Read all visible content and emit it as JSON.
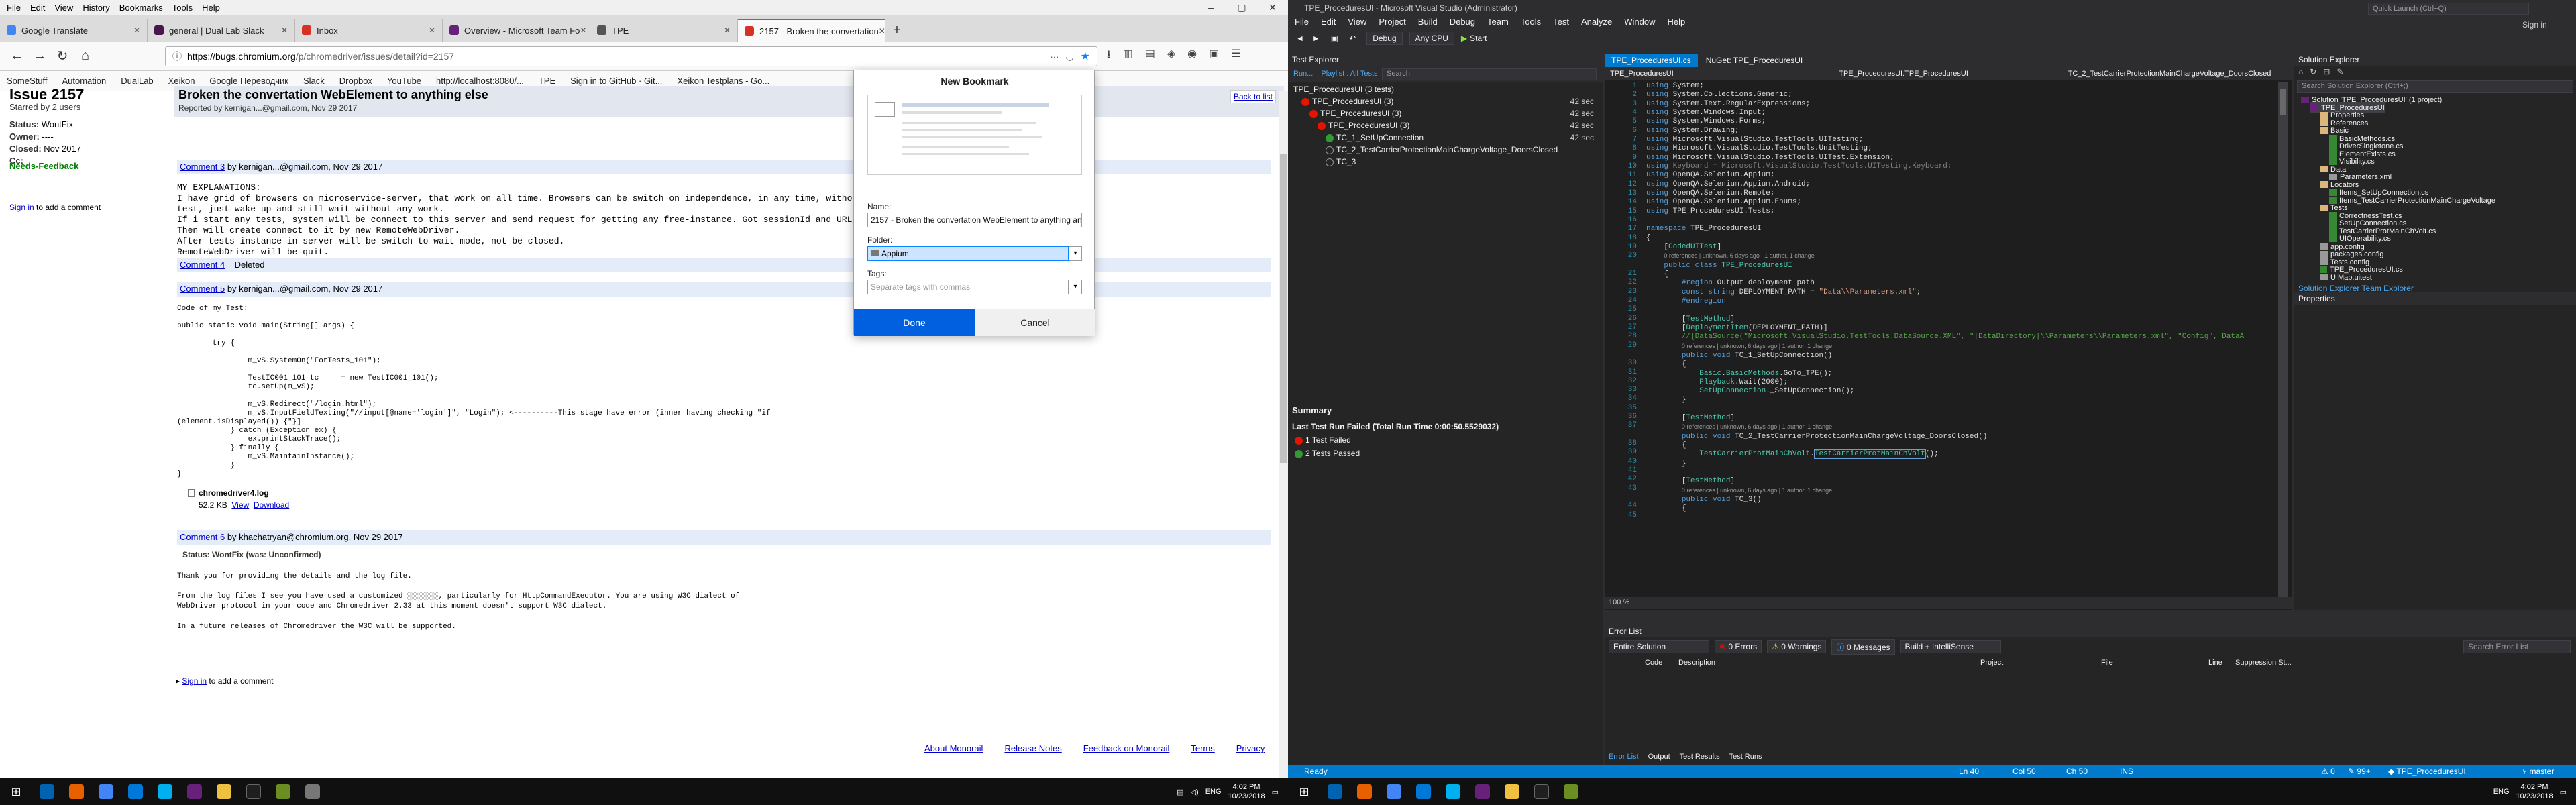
{
  "firefox": {
    "menu": [
      "File",
      "Edit",
      "View",
      "History",
      "Bookmarks",
      "Tools",
      "Help"
    ],
    "tabs": [
      {
        "label": "Google Translate",
        "color": "#4285f4"
      },
      {
        "label": "general | Dual Lab Slack",
        "color": "#4a154b"
      },
      {
        "label": "Inbox",
        "color": "#d93025"
      },
      {
        "label": "Overview - Microsoft Team Fo",
        "color": "#68217a"
      },
      {
        "label": "TPE",
        "color": "#555"
      },
      {
        "label": "2157 - Broken the convertation",
        "color": "#d93025"
      }
    ],
    "url_domain": "https://bugs.chromium.org",
    "url_path": "/p/chromedriver/issues/detail?id=2157",
    "bookmarks": [
      "SomeStuff",
      "Automation",
      "DualLab",
      "Xeikon",
      "Google Переводчик",
      "Slack",
      "Dropbox",
      "YouTube",
      "http://localhost:8080/...",
      "TPE",
      "Sign in to GitHub · Git...",
      "Xeikon Testplans - Go..."
    ],
    "issue": {
      "id": "Issue 2157",
      "title": "Broken the convertation WebElement to anything else",
      "reported": "Reported by kernigan...@gmail.com, Nov 29 2017",
      "back": "Back to list",
      "starred": "Starred by 2 users",
      "status_label": "Status:",
      "status": "WontFix",
      "owner_label": "Owner:",
      "owner": "----",
      "closed_label": "Closed:",
      "closed": "Nov 2017",
      "cc_label": "Cc:",
      "cc": "",
      "needs_label": "Needs-Feedback",
      "sidebar_signin": "Sign in",
      "sidebar_signin_rest": " to add a comment"
    },
    "comments": {
      "c3_link": "Comment 3",
      "c3_by": " by kernigan...@gmail.com, Nov 29 2017",
      "c3_body": "MY EXPLANATIONS:\nI have grid of browsers on microservice-server, that work on all time. Browsers can be switch on independence, in any time, without\ntest, just wake up and still wait without any work.\nIf i start any tests, system will be connect to this server and send request for getting any free-instance. Got sessionId and URL.\nThen will create connect to it by new RemoteWebDriver.\nAfter tests instance in server will be switch to wait-mode, not be closed.\nRemoteWebDriver will be quit.",
      "c4_link": "Comment 4",
      "c4_del": "Deleted",
      "c5_link": "Comment 5",
      "c5_by": " by kernigan...@gmail.com, Nov 29 2017",
      "c5_body": "Code of my Test:\n\npublic static void main(String[] args) {\n\n        try {\n\n                m_vS.SystemOn(\"ForTests_101\");\n\n                TestIC001_101 tc     = new TestIC001_101();\n                tc.setUp(m_vS);\n\n                m_vS.Redirect(\"/login.html\");\n                m_vS.InputFieldTexting(\"//input[@name='login']\", \"Login\"); <----------This stage have error (inner having checking \"if\n(element.isDisplayed()) {\"}]\n            } catch (Exception ex) {\n                ex.printStackTrace();\n            } finally {\n                m_vS.MaintainInstance();\n            }\n}",
      "att_name": "chromedriver4.log",
      "att_size": "52.2 KB",
      "att_view": "View",
      "att_dl": "Download",
      "c6_link": "Comment 6",
      "c6_by": " by khachatryan@chromium.org, Nov 29 2017",
      "c6_status": "Status: WontFix (was: Unconfirmed)",
      "c6_body": "Thank you for providing the details and the log file.\n\nFrom the log files I see you have used a customized ░░░░░░░, particularly for HttpCommandExecutor. You are using W3C dialect of\nWebDriver protocol in your code and Chromedriver 2.33 at this moment doesn't support W3C dialect.\n\nIn a future releases of Chromedriver the W3C will be supported.",
      "bottom_signin": "Sign in",
      "bottom_rest": " to add a comment"
    },
    "footer": [
      "About Monorail",
      "Release Notes",
      "Feedback on Monorail",
      "Terms",
      "Privacy"
    ],
    "bookmark_panel": {
      "title": "New Bookmark",
      "name_label": "Name:",
      "name_value": "2157 - Broken the convertation WebElement to anything anot",
      "folder_label": "Folder:",
      "folder_value": "Appium",
      "tags_label": "Tags:",
      "tags_placeholder": "Separate tags with commas",
      "done": "Done",
      "cancel": "Cancel"
    }
  },
  "vs": {
    "title": "TPE_ProceduresUI - Microsoft Visual Studio (Administrator)",
    "menu": [
      "File",
      "Edit",
      "View",
      "Project",
      "Build",
      "Debug",
      "Team",
      "Tools",
      "Test",
      "Analyze",
      "Window",
      "Help"
    ],
    "toolbar": {
      "start": "Start",
      "config": "Debug",
      "platform": "Any CPU"
    },
    "quick_launch": "Quick Launch (Ctrl+Q)",
    "signin": "Sign in",
    "test_explorer": {
      "title": "Test Explorer",
      "run": "Run...",
      "playlist": "Playlist : All Tests",
      "search": "Search",
      "rows": [
        {
          "label": "TPE_ProceduresUI (3 tests)",
          "dur": "",
          "icon": "none",
          "indent": 0
        },
        {
          "label": "TPE_ProceduresUI (3)",
          "dur": "42 sec",
          "icon": "fail",
          "indent": 1
        },
        {
          "label": "TPE_ProceduresUI (3)",
          "dur": "42 sec",
          "icon": "fail",
          "indent": 2
        },
        {
          "label": "TPE_ProceduresUI (3)",
          "dur": "42 sec",
          "icon": "fail",
          "indent": 3
        },
        {
          "label": "TC_1_SetUpConnection",
          "dur": "42 sec",
          "icon": "pass",
          "indent": 4
        },
        {
          "label": "TC_2_TestCarrierProtectionMainChargeVoltage_DoorsClosed",
          "dur": "",
          "icon": "nrun",
          "indent": 4
        },
        {
          "label": "TC_3",
          "dur": "",
          "icon": "nrun",
          "indent": 4
        }
      ],
      "summary_title": "Summary",
      "last_run": "Last Test Run Failed (Total Run Time 0:00:50.5529032)",
      "failed": "1 Test Failed",
      "passed": "2 Tests Passed"
    },
    "editor": {
      "tabs": [
        "TPE_ProceduresUI.cs",
        "NuGet: TPE_ProceduresUI"
      ],
      "nav": [
        "TPE_ProceduresUI",
        "TPE_ProceduresUI.TPE_ProceduresUI",
        "TC_2_TestCarrierProtectionMainChargeVoltage_DoorsClosed"
      ],
      "zoom": "100 %"
    },
    "solution": {
      "title": "Solution Explorer",
      "search": "Search Solution Explorer (Ctrl+;)",
      "items": [
        {
          "label": "Solution 'TPE_ProceduresUI' (1 project)",
          "kind": "sol",
          "indent": 0
        },
        {
          "label": "TPE_ProceduresUI",
          "kind": "proj",
          "indent": 1
        },
        {
          "label": "Properties",
          "kind": "fold",
          "indent": 2
        },
        {
          "label": "References",
          "kind": "fold",
          "indent": 2
        },
        {
          "label": "Basic",
          "kind": "fold",
          "indent": 2
        },
        {
          "label": "BasicMethods.cs",
          "kind": "cs",
          "indent": 3
        },
        {
          "label": "DriverSingletone.cs",
          "kind": "cs",
          "indent": 3
        },
        {
          "label": "ElementExists.cs",
          "kind": "cs",
          "indent": 3
        },
        {
          "label": "Visibility.cs",
          "kind": "cs",
          "indent": 3
        },
        {
          "label": "Data",
          "kind": "fold",
          "indent": 2
        },
        {
          "label": "Parameters.xml",
          "kind": "file",
          "indent": 3
        },
        {
          "label": "Locators",
          "kind": "fold",
          "indent": 2
        },
        {
          "label": "Items_SetUpConnection.cs",
          "kind": "cs",
          "indent": 3
        },
        {
          "label": "Items_TestCarrierProtectionMainChargeVoltage",
          "kind": "cs",
          "indent": 3
        },
        {
          "label": "Tests",
          "kind": "fold",
          "indent": 2
        },
        {
          "label": "CorrectnessTest.cs",
          "kind": "cs",
          "indent": 3
        },
        {
          "label": "SetUpConnection.cs",
          "kind": "cs",
          "indent": 3
        },
        {
          "label": "TestCarrierProtMainChVolt.cs",
          "kind": "cs",
          "indent": 3
        },
        {
          "label": "UIOperability.cs",
          "kind": "cs",
          "indent": 3
        },
        {
          "label": "app.config",
          "kind": "file",
          "indent": 2
        },
        {
          "label": "packages.config",
          "kind": "file",
          "indent": 2
        },
        {
          "label": "Tests.config",
          "kind": "file",
          "indent": 2
        },
        {
          "label": "TPE_ProceduresUI.cs",
          "kind": "cs",
          "indent": 2
        },
        {
          "label": "UIMap.uitest",
          "kind": "file",
          "indent": 2
        }
      ],
      "tabs": "Solution Explorer   Team Explorer",
      "properties": "Properties"
    },
    "error_list": {
      "title": "Error List",
      "scope": "Entire Solution",
      "errors": "0 Errors",
      "warnings": "0 Warnings",
      "messages": "0 Messages",
      "build": "Build + IntelliSense",
      "search": "Search Error List",
      "cols": [
        "Code",
        "Description",
        "Project",
        "File",
        "Line",
        "Suppression St..."
      ],
      "tabs": [
        "Error List",
        "Output",
        "Test Results",
        "Test Runs"
      ]
    },
    "status": {
      "ready": "Ready",
      "ln": "Ln 40",
      "col": "Col 50",
      "ch": "Ch 50",
      "ins": "INS",
      "warn": "0",
      "edits": "99+",
      "project": "TPE_ProceduresUI",
      "branch": "master"
    }
  },
  "taskbar": {
    "left": {
      "lang": "ENG",
      "time": "4:02 PM",
      "date": "10/23/2018"
    },
    "right": {
      "lang": "ENG",
      "time": "4:02 PM",
      "date": "10/23/2018"
    }
  }
}
